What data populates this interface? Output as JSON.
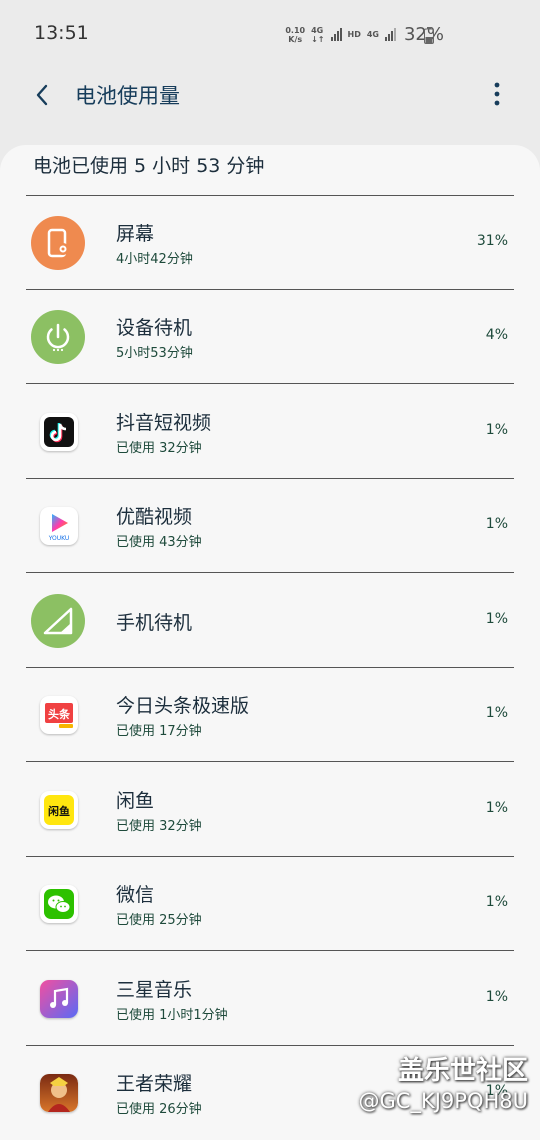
{
  "status_bar": {
    "time": "13:51",
    "net_speed_value": "0.10",
    "net_speed_unit": "K/s",
    "sim1_label": "4G",
    "hd_label": "HD",
    "sim2_label": "4G",
    "battery_percent": "32%"
  },
  "header": {
    "title": "电池使用量"
  },
  "summary": "电池已使用 5 小时 53 分钟",
  "items": [
    {
      "name": "屏幕",
      "sub": "4小时42分钟",
      "percent": "31%",
      "icon": "screen-icon"
    },
    {
      "name": "设备待机",
      "sub": "5小时53分钟",
      "percent": "4%",
      "icon": "power-icon"
    },
    {
      "name": "抖音短视频",
      "sub": "已使用 32分钟",
      "percent": "1%",
      "icon": "douyin-app-icon"
    },
    {
      "name": "优酷视频",
      "sub": "已使用 43分钟",
      "percent": "1%",
      "icon": "youku-app-icon"
    },
    {
      "name": "手机待机",
      "sub": "",
      "percent": "1%",
      "icon": "cell-signal-icon"
    },
    {
      "name": "今日头条极速版",
      "sub": "已使用 17分钟",
      "percent": "1%",
      "icon": "toutiao-app-icon"
    },
    {
      "name": "闲鱼",
      "sub": "已使用 32分钟",
      "percent": "1%",
      "icon": "xianyu-app-icon"
    },
    {
      "name": "微信",
      "sub": "已使用 25分钟",
      "percent": "1%",
      "icon": "wechat-app-icon"
    },
    {
      "name": "三星音乐",
      "sub": "已使用 1小时1分钟",
      "percent": "1%",
      "icon": "samsung-music-app-icon"
    },
    {
      "name": "王者荣耀",
      "sub": "已使用 26分钟",
      "percent": "1%",
      "icon": "honor-of-kings-app-icon"
    }
  ],
  "app_icon_text": {
    "youku": "YOUKU",
    "toutiao": "头条",
    "xianyu": "闲鱼"
  },
  "watermark": {
    "title": "盖乐世社区",
    "id": "@GC_KJ9PQH8U"
  },
  "colors": {
    "accent": "#173d5b",
    "screen_icon_bg": "#ef8a4f",
    "standby_icon_bg": "#8cc063",
    "phone_idle_icon_bg": "#8cc063",
    "wechat": "#2dc100",
    "music_gradient_start": "#f24fa0",
    "music_gradient_end": "#5a6af5"
  }
}
